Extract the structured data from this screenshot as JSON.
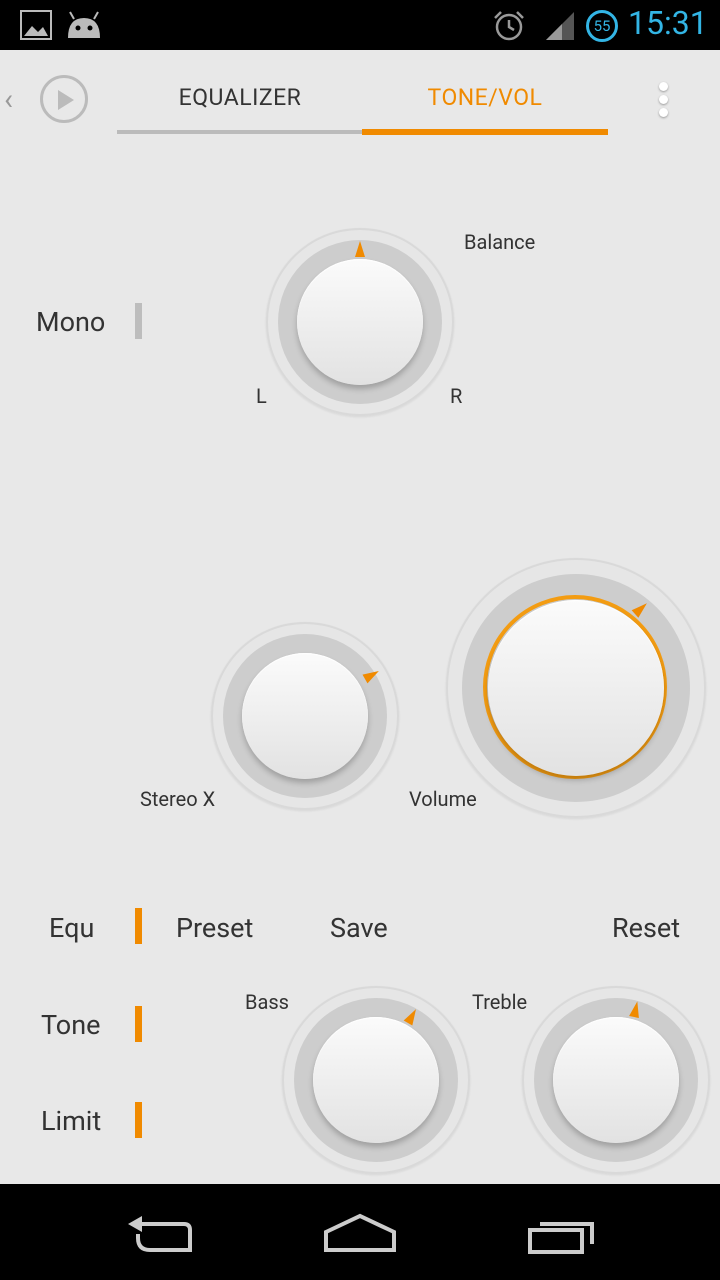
{
  "status_bar": {
    "time": "15:31",
    "notification_count": "55"
  },
  "toolbar": {
    "back_glyph": "‹"
  },
  "tabs": [
    {
      "label": "EQUALIZER",
      "active": false
    },
    {
      "label": "TONE/VOL",
      "active": true
    }
  ],
  "accent_color": "#f08a00",
  "balance": {
    "label": "Balance",
    "left_label": "L",
    "right_label": "R"
  },
  "mono": {
    "label": "Mono",
    "enabled": false
  },
  "stereo": {
    "label": "Stereo X"
  },
  "volume": {
    "label": "Volume"
  },
  "toggles": [
    {
      "key": "equ",
      "label": "Equ",
      "enabled": true
    },
    {
      "key": "tone",
      "label": "Tone",
      "enabled": true
    },
    {
      "key": "limit",
      "label": "Limit",
      "enabled": true
    }
  ],
  "actions": {
    "preset": "Preset",
    "save": "Save",
    "reset": "Reset"
  },
  "bass": {
    "label": "Bass"
  },
  "treble": {
    "label": "Treble"
  }
}
